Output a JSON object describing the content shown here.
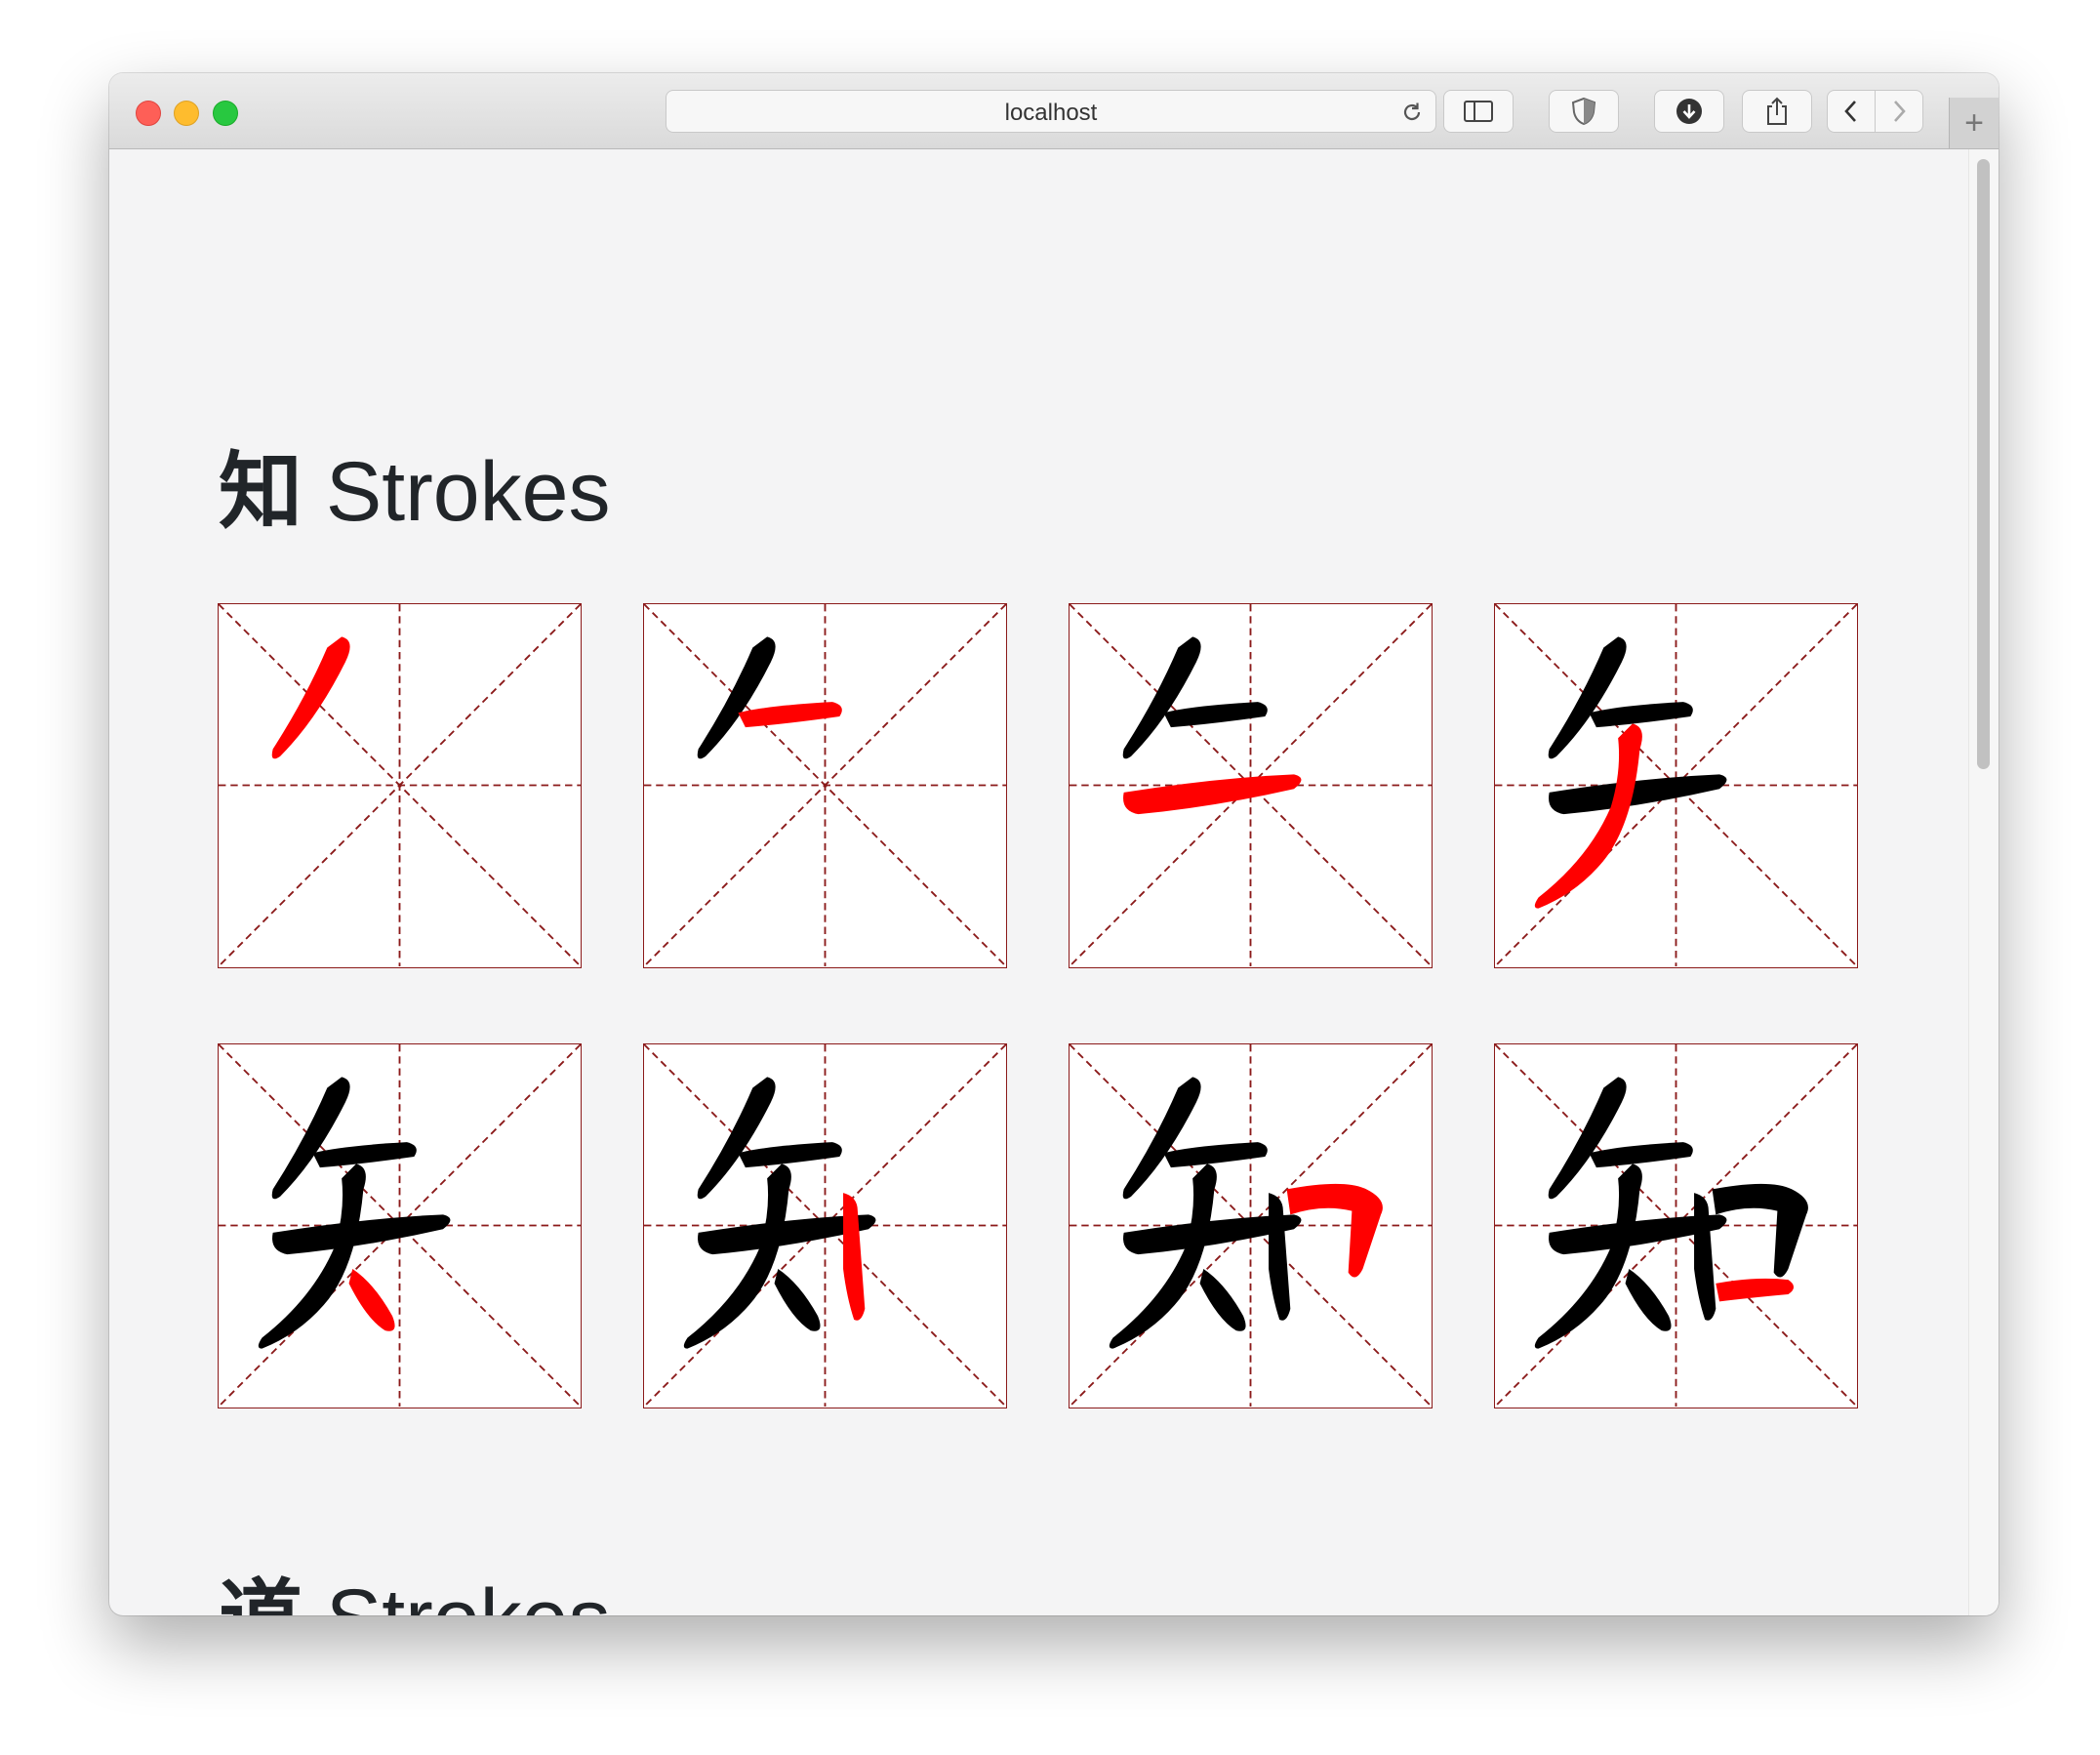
{
  "browser": {
    "url": "localhost",
    "buttons": [
      "sidebar-icon",
      "shield-icon",
      "download-icon",
      "share-icon",
      "back-icon",
      "forward-icon"
    ],
    "new_tab_label": "+"
  },
  "sections": [
    {
      "character": "知",
      "label": "Strokes",
      "stroke_count": 8
    },
    {
      "character": "道",
      "label": "Strokes"
    }
  ],
  "colors": {
    "current_stroke": "#ff0000",
    "previous_strokes": "#000000",
    "grid_lines": "#8b1a1a",
    "page_background": "#f4f4f5",
    "title_text": "#212529"
  }
}
